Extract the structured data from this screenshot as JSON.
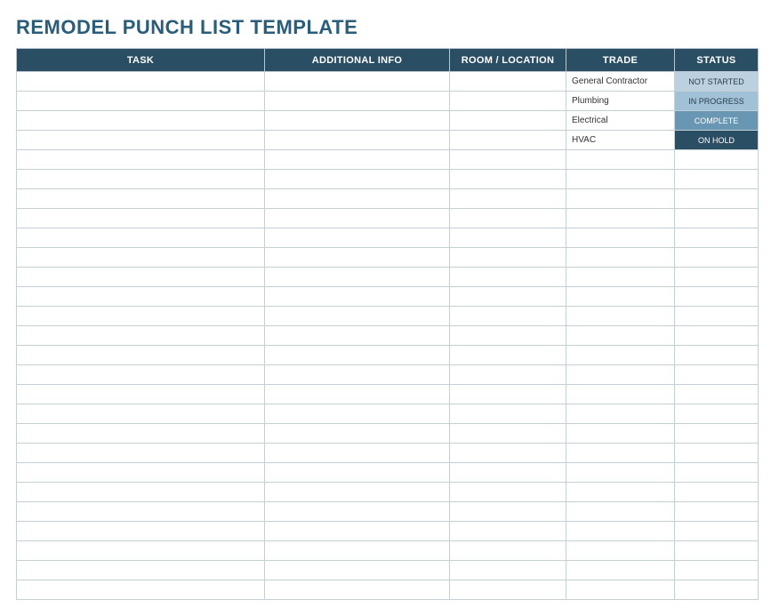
{
  "title": "REMODEL PUNCH LIST TEMPLATE",
  "columns": {
    "task": "TASK",
    "info": "ADDITIONAL INFO",
    "room": "ROOM / LOCATION",
    "trade": "TRADE",
    "status": "STATUS"
  },
  "statusStyles": {
    "NOT STARTED": "status-not-started",
    "IN PROGRESS": "status-in-progress",
    "COMPLETE": "status-complete",
    "ON HOLD": "status-on-hold"
  },
  "rows": [
    {
      "task": "",
      "info": "",
      "room": "",
      "trade": "General Contractor",
      "status": "NOT STARTED"
    },
    {
      "task": "",
      "info": "",
      "room": "",
      "trade": "Plumbing",
      "status": "IN PROGRESS"
    },
    {
      "task": "",
      "info": "",
      "room": "",
      "trade": "Electrical",
      "status": "COMPLETE"
    },
    {
      "task": "",
      "info": "",
      "room": "",
      "trade": "HVAC",
      "status": "ON HOLD"
    },
    {
      "task": "",
      "info": "",
      "room": "",
      "trade": "",
      "status": ""
    },
    {
      "task": "",
      "info": "",
      "room": "",
      "trade": "",
      "status": ""
    },
    {
      "task": "",
      "info": "",
      "room": "",
      "trade": "",
      "status": ""
    },
    {
      "task": "",
      "info": "",
      "room": "",
      "trade": "",
      "status": ""
    },
    {
      "task": "",
      "info": "",
      "room": "",
      "trade": "",
      "status": ""
    },
    {
      "task": "",
      "info": "",
      "room": "",
      "trade": "",
      "status": ""
    },
    {
      "task": "",
      "info": "",
      "room": "",
      "trade": "",
      "status": ""
    },
    {
      "task": "",
      "info": "",
      "room": "",
      "trade": "",
      "status": ""
    },
    {
      "task": "",
      "info": "",
      "room": "",
      "trade": "",
      "status": ""
    },
    {
      "task": "",
      "info": "",
      "room": "",
      "trade": "",
      "status": ""
    },
    {
      "task": "",
      "info": "",
      "room": "",
      "trade": "",
      "status": ""
    },
    {
      "task": "",
      "info": "",
      "room": "",
      "trade": "",
      "status": ""
    },
    {
      "task": "",
      "info": "",
      "room": "",
      "trade": "",
      "status": ""
    },
    {
      "task": "",
      "info": "",
      "room": "",
      "trade": "",
      "status": ""
    },
    {
      "task": "",
      "info": "",
      "room": "",
      "trade": "",
      "status": ""
    },
    {
      "task": "",
      "info": "",
      "room": "",
      "trade": "",
      "status": ""
    },
    {
      "task": "",
      "info": "",
      "room": "",
      "trade": "",
      "status": ""
    },
    {
      "task": "",
      "info": "",
      "room": "",
      "trade": "",
      "status": ""
    },
    {
      "task": "",
      "info": "",
      "room": "",
      "trade": "",
      "status": ""
    },
    {
      "task": "",
      "info": "",
      "room": "",
      "trade": "",
      "status": ""
    },
    {
      "task": "",
      "info": "",
      "room": "",
      "trade": "",
      "status": ""
    },
    {
      "task": "",
      "info": "",
      "room": "",
      "trade": "",
      "status": ""
    },
    {
      "task": "",
      "info": "",
      "room": "",
      "trade": "",
      "status": ""
    }
  ]
}
